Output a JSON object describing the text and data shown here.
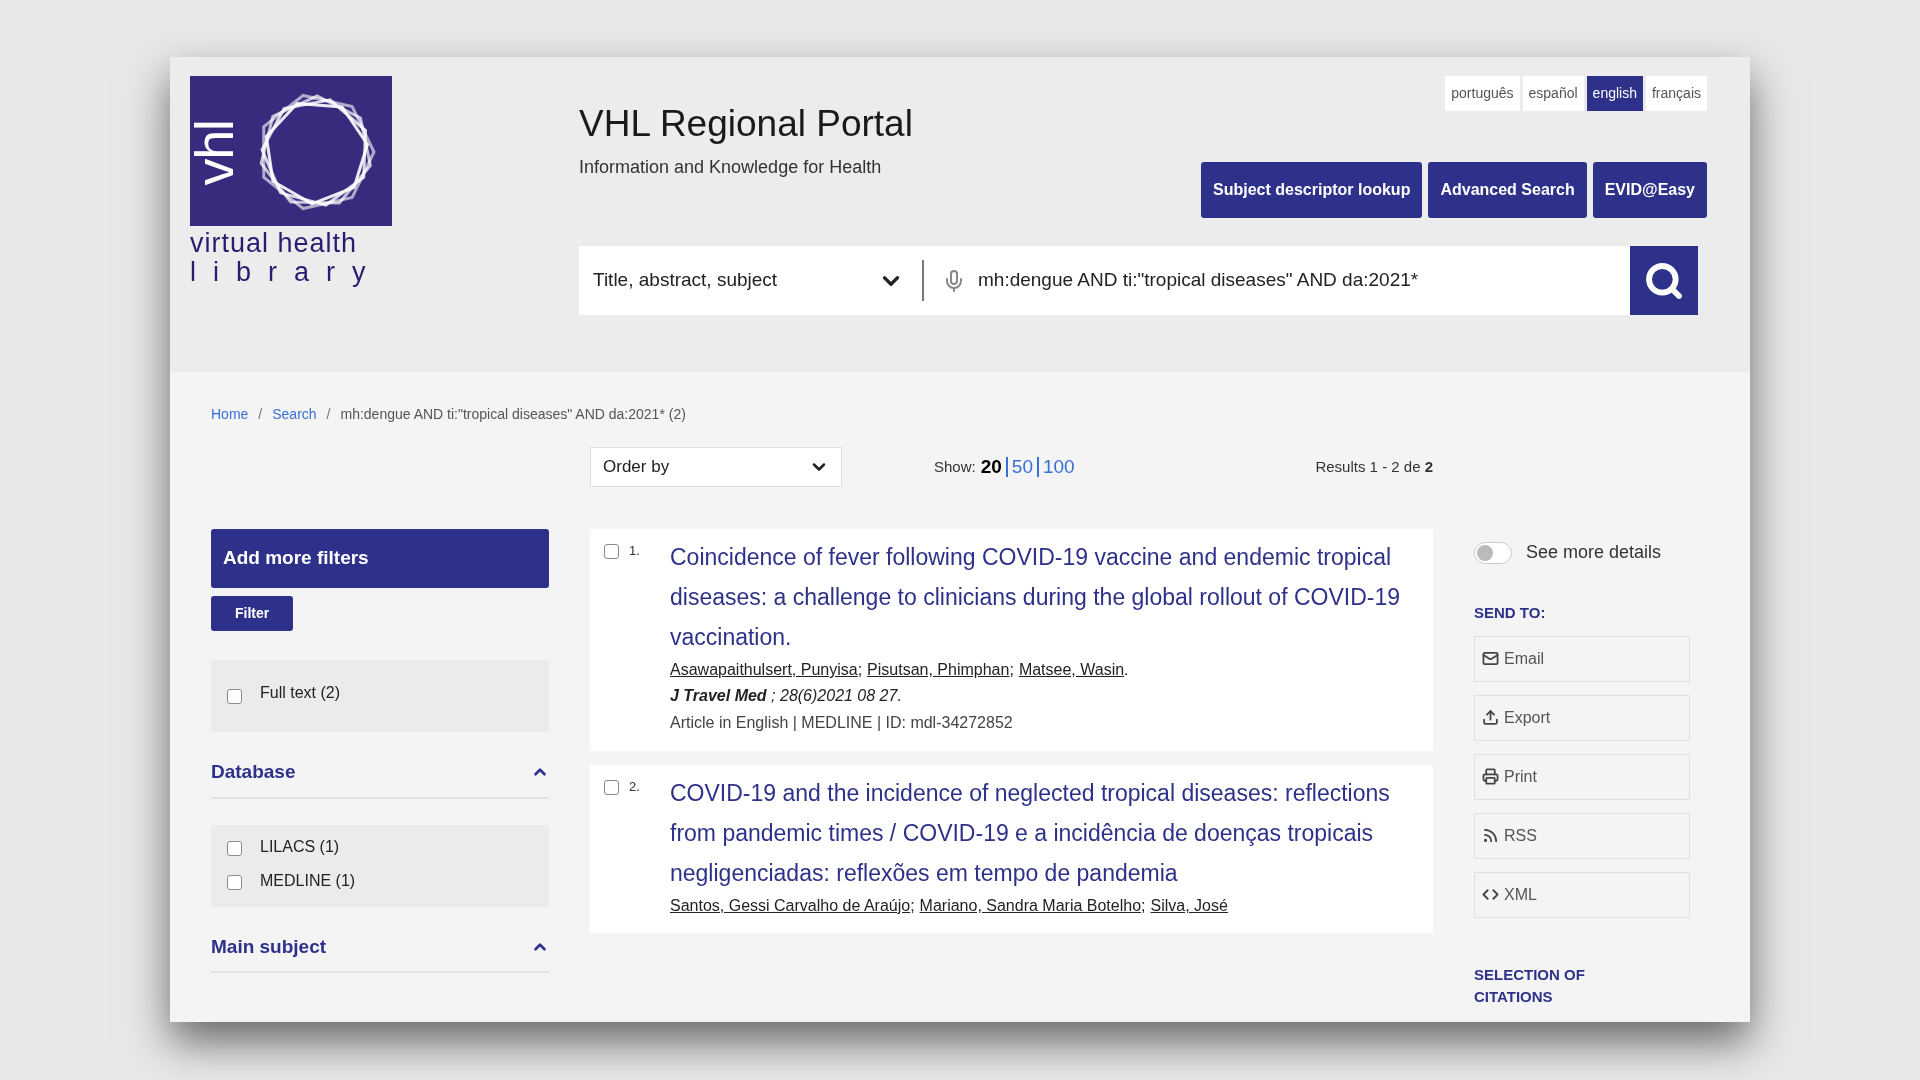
{
  "logo": {
    "vertical_text": "vhl",
    "line_1": "virtual health",
    "line_2": "library"
  },
  "header": {
    "title": "VHL Regional Portal",
    "subtitle": "Information and Knowledge for Health"
  },
  "languages": [
    {
      "label": "português",
      "selected": false
    },
    {
      "label": "español",
      "selected": false
    },
    {
      "label": "english",
      "selected": true
    },
    {
      "label": "français",
      "selected": false
    }
  ],
  "header_buttons": [
    "Subject descriptor lookup",
    "Advanced Search",
    "EVID@Easy"
  ],
  "search": {
    "field_select": "Title, abstract, subject",
    "query": "mh:dengue AND ti:\"tropical diseases\" AND da:2021*"
  },
  "breadcrumb": [
    {
      "label": "Home",
      "kind": "link",
      "separator": "/"
    },
    {
      "label": "Search",
      "kind": "link",
      "separator": "/"
    },
    {
      "label": "mh:dengue AND ti:\"tropical diseases\" AND da:2021* (2)",
      "kind": "current"
    }
  ],
  "order_by": "Order by",
  "show": {
    "label": "Show:",
    "options": [
      {
        "label": "20",
        "selected": true
      },
      {
        "label": "50",
        "selected": false
      },
      {
        "label": "100",
        "selected": false
      }
    ]
  },
  "results_count": "Results 1 - 2 de **2**",
  "sidebar": {
    "add_filters": "Add more filters",
    "filter_button": "Filter",
    "full_text": {
      "label": "Full text (2)",
      "checked": false
    },
    "groups": [
      {
        "title": "Database",
        "expanded": true,
        "options": [
          {
            "label": "LILACS (1)",
            "checked": false
          },
          {
            "label": "MEDLINE (1)",
            "checked": false
          }
        ]
      },
      {
        "title": "Main subject",
        "expanded": true
      }
    ]
  },
  "results": [
    {
      "number": "1.",
      "checked": false,
      "title": "Coincidence of fever following COVID-19 vaccine and endemic tropical diseases: a challenge to clinicians during the global rollout of COVID-19 vaccination.",
      "authors": [
        {
          "name": "Asawapaithulsert, Punyisa",
          "sep": ";"
        },
        {
          "name": "Pisutsan, Phimphan",
          "sep": ";"
        },
        {
          "name": "Matsee, Wasin",
          "sep": "."
        }
      ],
      "source": "**J Travel Med** ; 28(6)2021 08 27.",
      "meta": "Article in English | MEDLINE | ID: mdl-34272852"
    },
    {
      "number": "2.",
      "checked": false,
      "title": "COVID-19 and the incidence of neglected tropical diseases: reflections from pandemic times / COVID-19 e a incidência de doenças tropicais negligenciadas: reflexões em tempo de pandemia",
      "authors": [
        {
          "name": "Santos, Gessi Carvalho de Araújo",
          "sep": ";"
        },
        {
          "name": "Mariano, Sandra Maria Botelho",
          "sep": ";"
        },
        {
          "name": "Silva, José"
        }
      ]
    }
  ],
  "right": {
    "toggle": {
      "label": "See more details",
      "on": false
    },
    "send_to_title": "SEND TO:",
    "send_to": [
      {
        "label": "Email",
        "kind": "email"
      },
      {
        "label": "Export",
        "kind": "export"
      },
      {
        "label": "Print",
        "kind": "print"
      },
      {
        "label": "RSS",
        "kind": "rss"
      },
      {
        "label": "XML",
        "kind": "xml"
      }
    ],
    "selection_title": "SELECTION OF CITATIONS"
  }
}
